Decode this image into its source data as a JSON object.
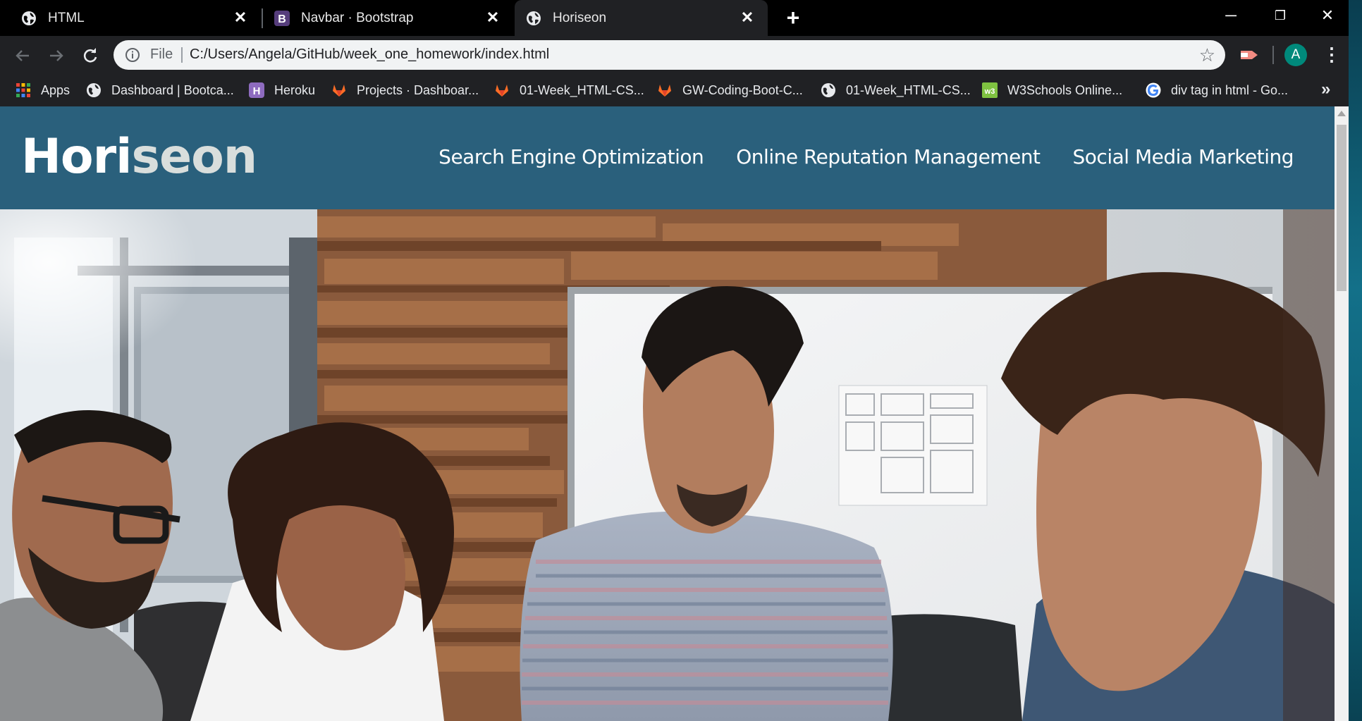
{
  "browser": {
    "tabs": [
      {
        "title": "HTML",
        "icon": "globe-icon",
        "active": false
      },
      {
        "title": "Navbar · Bootstrap",
        "icon": "bootstrap-icon",
        "active": false
      },
      {
        "title": "Horiseon",
        "icon": "globe-icon",
        "active": true
      }
    ],
    "new_tab_label": "+",
    "window_controls": {
      "minimize": "─",
      "restore": "❐",
      "close": "✕"
    },
    "address_bar": {
      "scheme_label": "File",
      "url": "C:/Users/Angela/GitHub/week_one_homework/index.html"
    },
    "profile_initial": "A",
    "bookmarks": [
      {
        "label": "Apps",
        "icon": "apps-grid-icon"
      },
      {
        "label": "Dashboard | Bootca...",
        "icon": "globe-icon"
      },
      {
        "label": "Heroku",
        "icon": "heroku-icon"
      },
      {
        "label": "Projects · Dashboar...",
        "icon": "gitlab-icon"
      },
      {
        "label": "01-Week_HTML-CS...",
        "icon": "gitlab-icon"
      },
      {
        "label": "GW-Coding-Boot-C...",
        "icon": "gitlab-icon"
      },
      {
        "label": "01-Week_HTML-CS...",
        "icon": "globe-icon"
      },
      {
        "label": "W3Schools Online...",
        "icon": "w3schools-icon"
      },
      {
        "label": "div tag in html - Go...",
        "icon": "google-icon"
      }
    ],
    "bookmarks_overflow": "»"
  },
  "page": {
    "logo_part1": "Hori",
    "logo_part2": "seon",
    "nav": [
      "Search Engine Optimization",
      "Online Reputation Management",
      "Social Media Marketing"
    ]
  },
  "colors": {
    "header_bg": "#2a607c",
    "tab_active": "#202124",
    "avatar": "#00897b"
  }
}
